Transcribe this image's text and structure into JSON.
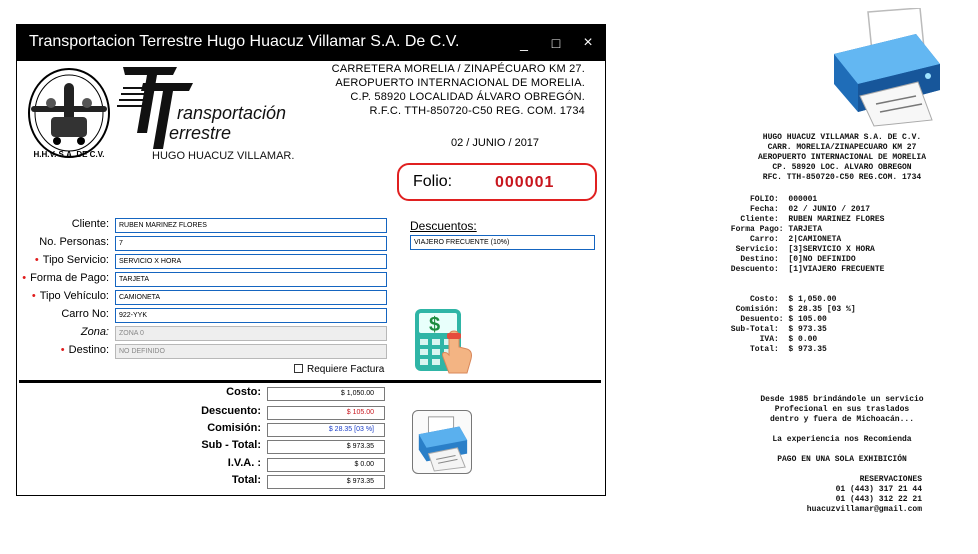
{
  "window": {
    "title": "Transportacion Terrestre Hugo Huacuz Villamar S.A. De C.V.",
    "minimize": "_",
    "maximize": "□",
    "close": "×"
  },
  "company": {
    "logo_text": "H.H.V. S.A. DE C.V.",
    "brand_line1": "ransportación",
    "brand_line2": "errestre",
    "owner": "HUGO HUACUZ VILLAMAR."
  },
  "address": {
    "line1": "CARRETERA MORELIA / ZINAPÉCUARO KM 27.",
    "line2": "AEROPUERTO INTERNACIONAL DE MORELIA.",
    "line3": "C.P. 58920    LOCALIDAD ÁLVARO OBREGÓN.",
    "line4": "R.F.C.  TTH-850720-C50   REG. COM.  1734"
  },
  "date": "02 / JUNIO / 2017",
  "folio": {
    "label": "Folio:",
    "value": "000001"
  },
  "form": {
    "cliente": {
      "label": "Cliente:",
      "value": "RUBEN MARINEZ FLORES"
    },
    "personas": {
      "label": "No. Personas:",
      "value": "7"
    },
    "tipo_servicio": {
      "label": "Tipo Servicio:",
      "value": "SERVICIO X HORA"
    },
    "forma_pago": {
      "label": "Forma de Pago:",
      "value": "TARJETA"
    },
    "tipo_vehiculo": {
      "label": "Tipo Vehículo:",
      "value": "CAMIONETA"
    },
    "carro": {
      "label": "Carro No:",
      "value": "922-YYK"
    },
    "zona": {
      "label": "Zona:",
      "value": "ZONA 0"
    },
    "destino": {
      "label": "Destino:",
      "value": "NO DEFINIDO"
    },
    "required_mark": "•"
  },
  "descuentos": {
    "title": "Descuentos:",
    "value": "VIAJERO FRECUENTE (10%)"
  },
  "requiere_factura": "Requiere Factura",
  "totals": {
    "costo": {
      "label": "Costo:",
      "value": "$ 1,050.00",
      "color": "#000000"
    },
    "descuento": {
      "label": "Descuento:",
      "value": "$ 105.00",
      "color": "#c8161e"
    },
    "comision": {
      "label": "Comisión:",
      "value": "$ 28.35 [03 %]",
      "color": "#1e40c8"
    },
    "subtotal": {
      "label": "Sub - Total:",
      "value": "$ 973.35",
      "color": "#000000"
    },
    "iva": {
      "label": "I.V.A. :",
      "value": "$ 0.00",
      "color": "#000000"
    },
    "total": {
      "label": "Total:",
      "value": "$ 973.35",
      "color": "#000000"
    }
  },
  "receipt": {
    "header": [
      "HUGO HUACUZ VILLAMAR S.A. DE C.V.",
      "CARR. MORELIA/ZINAPECUARO KM 27",
      "AEROPUERTO INTERNACIONAL DE MORELIA",
      "CP. 58920 LOC. ALVARO OBREGON",
      "RFC. TTH-850720-C50 REG.COM. 1734"
    ],
    "details": [
      "     FOLIO:  000001",
      "     Fecha:  02 / JUNIO / 2017",
      "   Cliente:  RUBEN MARINEZ FLORES",
      " Forma Pago: TARJETA",
      "     Carro:  2|CAMIONETA",
      "  Servicio:  [3]SERVICIO X HORA",
      "   Destino:  [0]NO DEFINIDO",
      " Descuento:  [1]VIAJERO FRECUENTE"
    ],
    "amounts": [
      "     Costo:  $ 1,050.00",
      "  Comisión:  $ 28.35 [03 %]",
      "   Desuento: $ 105.00",
      " Sub-Total:  $ 973.35",
      "       IVA:  $ 0.00",
      "     Total:  $ 973.35"
    ],
    "footer": [
      "Desde 1985 brindándole un servicio",
      "Profecional en sus traslados",
      "dentro y fuera de Michoacán..."
    ],
    "slogan": "La experiencia nos Recomienda",
    "payment": "PAGO EN UNA SOLA EXHIBICIÓN",
    "reservations": [
      "RESERVACIONES",
      "01 (443) 317 21 44",
      "01 (443) 312 22 21",
      "huacuzvillamar@gmail.com"
    ]
  }
}
